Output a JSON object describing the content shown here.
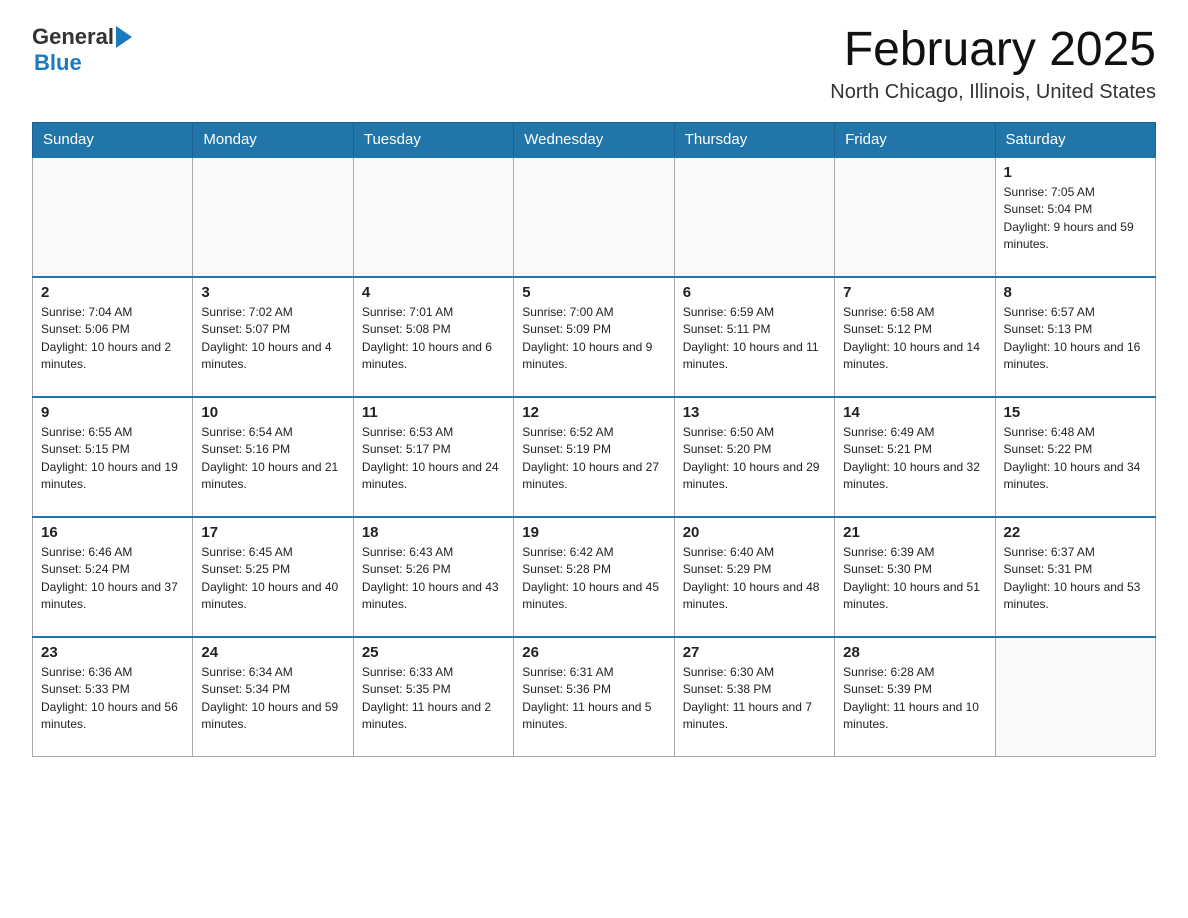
{
  "header": {
    "logo_general": "General",
    "logo_blue": "Blue",
    "month_title": "February 2025",
    "location": "North Chicago, Illinois, United States"
  },
  "weekdays": [
    "Sunday",
    "Monday",
    "Tuesday",
    "Wednesday",
    "Thursday",
    "Friday",
    "Saturday"
  ],
  "weeks": [
    [
      {
        "day": "",
        "info": ""
      },
      {
        "day": "",
        "info": ""
      },
      {
        "day": "",
        "info": ""
      },
      {
        "day": "",
        "info": ""
      },
      {
        "day": "",
        "info": ""
      },
      {
        "day": "",
        "info": ""
      },
      {
        "day": "1",
        "info": "Sunrise: 7:05 AM\nSunset: 5:04 PM\nDaylight: 9 hours and 59 minutes."
      }
    ],
    [
      {
        "day": "2",
        "info": "Sunrise: 7:04 AM\nSunset: 5:06 PM\nDaylight: 10 hours and 2 minutes."
      },
      {
        "day": "3",
        "info": "Sunrise: 7:02 AM\nSunset: 5:07 PM\nDaylight: 10 hours and 4 minutes."
      },
      {
        "day": "4",
        "info": "Sunrise: 7:01 AM\nSunset: 5:08 PM\nDaylight: 10 hours and 6 minutes."
      },
      {
        "day": "5",
        "info": "Sunrise: 7:00 AM\nSunset: 5:09 PM\nDaylight: 10 hours and 9 minutes."
      },
      {
        "day": "6",
        "info": "Sunrise: 6:59 AM\nSunset: 5:11 PM\nDaylight: 10 hours and 11 minutes."
      },
      {
        "day": "7",
        "info": "Sunrise: 6:58 AM\nSunset: 5:12 PM\nDaylight: 10 hours and 14 minutes."
      },
      {
        "day": "8",
        "info": "Sunrise: 6:57 AM\nSunset: 5:13 PM\nDaylight: 10 hours and 16 minutes."
      }
    ],
    [
      {
        "day": "9",
        "info": "Sunrise: 6:55 AM\nSunset: 5:15 PM\nDaylight: 10 hours and 19 minutes."
      },
      {
        "day": "10",
        "info": "Sunrise: 6:54 AM\nSunset: 5:16 PM\nDaylight: 10 hours and 21 minutes."
      },
      {
        "day": "11",
        "info": "Sunrise: 6:53 AM\nSunset: 5:17 PM\nDaylight: 10 hours and 24 minutes."
      },
      {
        "day": "12",
        "info": "Sunrise: 6:52 AM\nSunset: 5:19 PM\nDaylight: 10 hours and 27 minutes."
      },
      {
        "day": "13",
        "info": "Sunrise: 6:50 AM\nSunset: 5:20 PM\nDaylight: 10 hours and 29 minutes."
      },
      {
        "day": "14",
        "info": "Sunrise: 6:49 AM\nSunset: 5:21 PM\nDaylight: 10 hours and 32 minutes."
      },
      {
        "day": "15",
        "info": "Sunrise: 6:48 AM\nSunset: 5:22 PM\nDaylight: 10 hours and 34 minutes."
      }
    ],
    [
      {
        "day": "16",
        "info": "Sunrise: 6:46 AM\nSunset: 5:24 PM\nDaylight: 10 hours and 37 minutes."
      },
      {
        "day": "17",
        "info": "Sunrise: 6:45 AM\nSunset: 5:25 PM\nDaylight: 10 hours and 40 minutes."
      },
      {
        "day": "18",
        "info": "Sunrise: 6:43 AM\nSunset: 5:26 PM\nDaylight: 10 hours and 43 minutes."
      },
      {
        "day": "19",
        "info": "Sunrise: 6:42 AM\nSunset: 5:28 PM\nDaylight: 10 hours and 45 minutes."
      },
      {
        "day": "20",
        "info": "Sunrise: 6:40 AM\nSunset: 5:29 PM\nDaylight: 10 hours and 48 minutes."
      },
      {
        "day": "21",
        "info": "Sunrise: 6:39 AM\nSunset: 5:30 PM\nDaylight: 10 hours and 51 minutes."
      },
      {
        "day": "22",
        "info": "Sunrise: 6:37 AM\nSunset: 5:31 PM\nDaylight: 10 hours and 53 minutes."
      }
    ],
    [
      {
        "day": "23",
        "info": "Sunrise: 6:36 AM\nSunset: 5:33 PM\nDaylight: 10 hours and 56 minutes."
      },
      {
        "day": "24",
        "info": "Sunrise: 6:34 AM\nSunset: 5:34 PM\nDaylight: 10 hours and 59 minutes."
      },
      {
        "day": "25",
        "info": "Sunrise: 6:33 AM\nSunset: 5:35 PM\nDaylight: 11 hours and 2 minutes."
      },
      {
        "day": "26",
        "info": "Sunrise: 6:31 AM\nSunset: 5:36 PM\nDaylight: 11 hours and 5 minutes."
      },
      {
        "day": "27",
        "info": "Sunrise: 6:30 AM\nSunset: 5:38 PM\nDaylight: 11 hours and 7 minutes."
      },
      {
        "day": "28",
        "info": "Sunrise: 6:28 AM\nSunset: 5:39 PM\nDaylight: 11 hours and 10 minutes."
      },
      {
        "day": "",
        "info": ""
      }
    ]
  ]
}
